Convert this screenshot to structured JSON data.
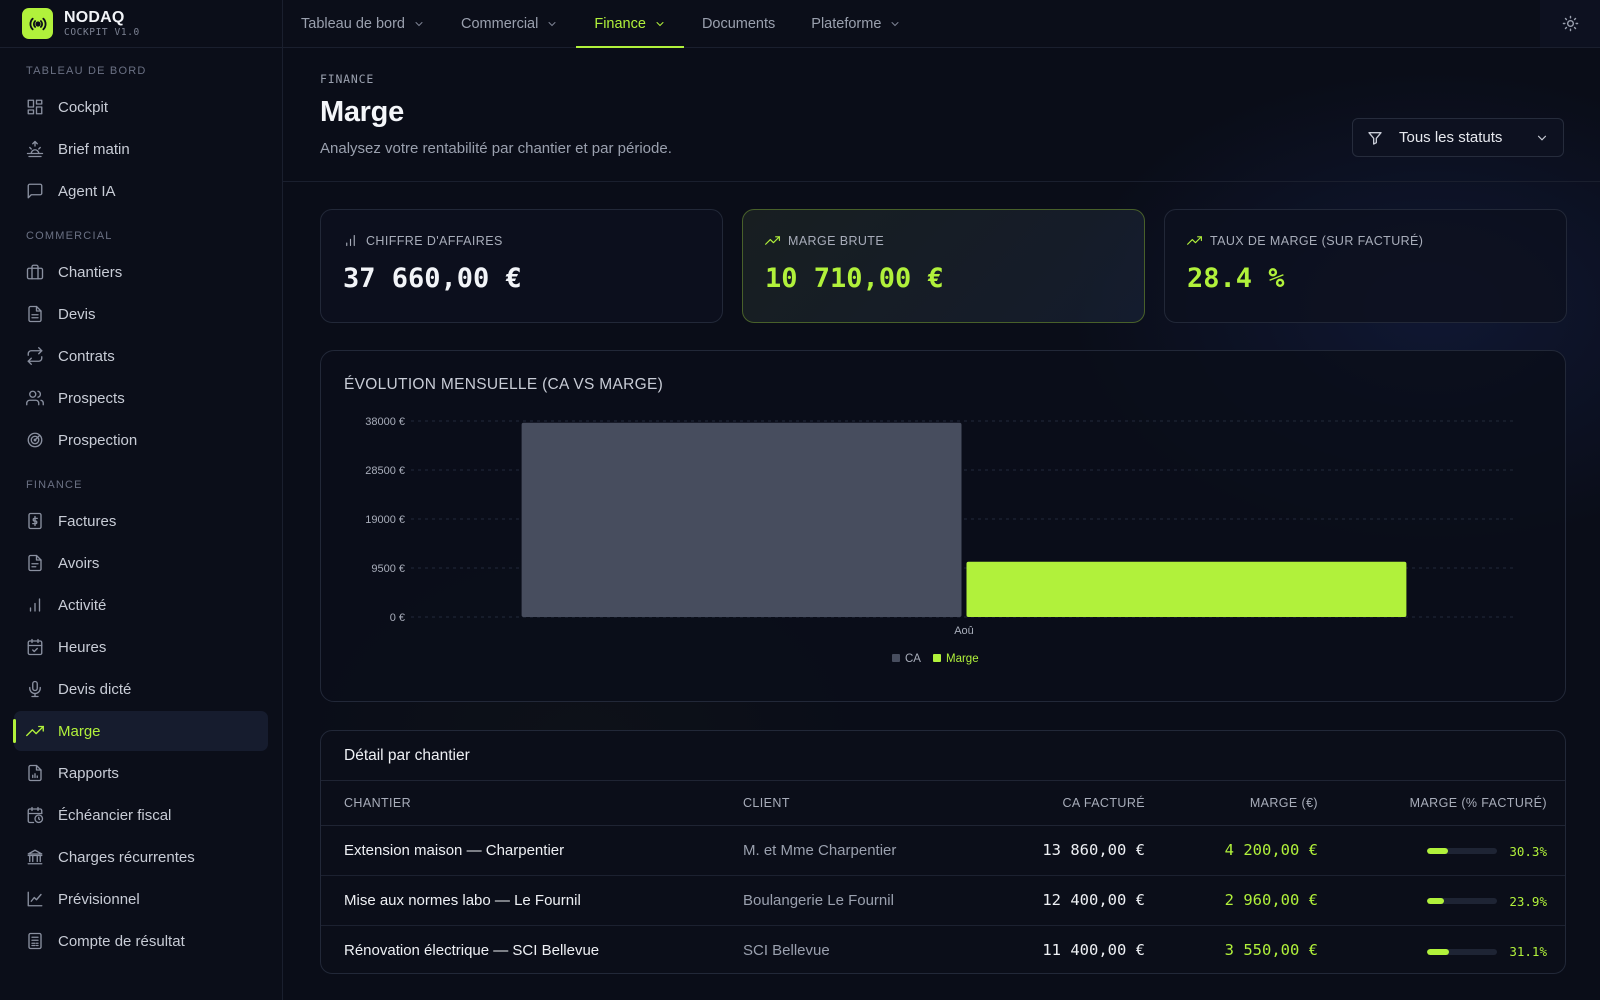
{
  "brand": {
    "name": "NODAQ",
    "subtitle": "COCKPIT V1.0"
  },
  "sidebar": {
    "sections": [
      {
        "title": "TABLEAU DE BORD",
        "items": [
          {
            "label": "Cockpit",
            "icon": "grid-icon"
          },
          {
            "label": "Brief matin",
            "icon": "sunrise-icon"
          },
          {
            "label": "Agent IA",
            "icon": "chat-icon"
          }
        ]
      },
      {
        "title": "COMMERCIAL",
        "items": [
          {
            "label": "Chantiers",
            "icon": "briefcase-icon"
          },
          {
            "label": "Devis",
            "icon": "document-icon"
          },
          {
            "label": "Contrats",
            "icon": "repeat-icon"
          },
          {
            "label": "Prospects",
            "icon": "users-icon"
          },
          {
            "label": "Prospection",
            "icon": "radar-icon"
          }
        ]
      },
      {
        "title": "FINANCE",
        "items": [
          {
            "label": "Factures",
            "icon": "dollar-file-icon"
          },
          {
            "label": "Avoirs",
            "icon": "file-text-icon"
          },
          {
            "label": "Activité",
            "icon": "bar-chart-icon"
          },
          {
            "label": "Heures",
            "icon": "calendar-check-icon"
          },
          {
            "label": "Devis dicté",
            "icon": "microphone-icon"
          },
          {
            "label": "Marge",
            "icon": "trending-up-icon",
            "active": true
          },
          {
            "label": "Rapports",
            "icon": "report-icon"
          },
          {
            "label": "Échéancier fiscal",
            "icon": "calendar-clock-icon"
          },
          {
            "label": "Charges récurrentes",
            "icon": "bank-icon"
          },
          {
            "label": "Prévisionnel",
            "icon": "line-chart-icon"
          },
          {
            "label": "Compte de résultat",
            "icon": "ledger-icon"
          }
        ]
      }
    ]
  },
  "topnav": {
    "tabs": [
      {
        "label": "Tableau de bord",
        "dropdown": true
      },
      {
        "label": "Commercial",
        "dropdown": true
      },
      {
        "label": "Finance",
        "dropdown": true,
        "active": true
      },
      {
        "label": "Documents",
        "dropdown": false
      },
      {
        "label": "Plateforme",
        "dropdown": true
      }
    ],
    "theme_icon": "sun-icon"
  },
  "header": {
    "eyebrow": "FINANCE",
    "title": "Marge",
    "subtitle": "Analysez votre rentabilité par chantier et par période.",
    "filter": {
      "label": "Tous les statuts",
      "icon": "filter-icon"
    }
  },
  "kpis": [
    {
      "label": "CHIFFRE D'AFFAIRES",
      "value": "37 660,00 €",
      "icon": "bar-chart-icon",
      "style": "plain"
    },
    {
      "label": "MARGE BRUTE",
      "value": "10 710,00 €",
      "icon": "trending-up-icon",
      "style": "accent"
    },
    {
      "label": "TAUX DE MARGE (SUR FACTURÉ)",
      "value": "28.4 %",
      "icon": "trending-up-icon",
      "style": "lime"
    }
  ],
  "chart": {
    "title": "ÉVOLUTION MENSUELLE (CA VS MARGE)"
  },
  "chart_data": {
    "type": "bar",
    "categories": [
      "Aoû"
    ],
    "series": [
      {
        "name": "CA",
        "values": [
          37660
        ],
        "color": "#474d5e"
      },
      {
        "name": "Marge",
        "values": [
          10710
        ],
        "color": "#b1f13b"
      }
    ],
    "yticks": [
      "0 €",
      "9500 €",
      "19000 €",
      "28500 €",
      "38000 €"
    ],
    "ylim": [
      0,
      38000
    ],
    "grid": true,
    "legend": "bottom-center"
  },
  "table": {
    "title": "Détail par chantier",
    "columns": [
      "CHANTIER",
      "CLIENT",
      "CA FACTURÉ",
      "MARGE (€)",
      "MARGE (% FACTURÉ)"
    ],
    "rows": [
      {
        "chantier": "Extension maison — Charpentier",
        "client": "M. et Mme Charpentier",
        "ca": "13 860,00 €",
        "marge": "4 200,00 €",
        "pct": "30.3%",
        "pct_value": 30.3
      },
      {
        "chantier": "Mise aux normes labo — Le Fournil",
        "client": "Boulangerie Le Fournil",
        "ca": "12 400,00 €",
        "marge": "2 960,00 €",
        "pct": "23.9%",
        "pct_value": 23.9
      },
      {
        "chantier": "Rénovation électrique — SCI Bellevue",
        "client": "SCI Bellevue",
        "ca": "11 400,00 €",
        "marge": "3 550,00 €",
        "pct": "31.1%",
        "pct_value": 31.1
      }
    ]
  },
  "colors": {
    "accent": "#b1f13b",
    "background": "#0a0d18",
    "ca_bar": "#474d5e"
  }
}
